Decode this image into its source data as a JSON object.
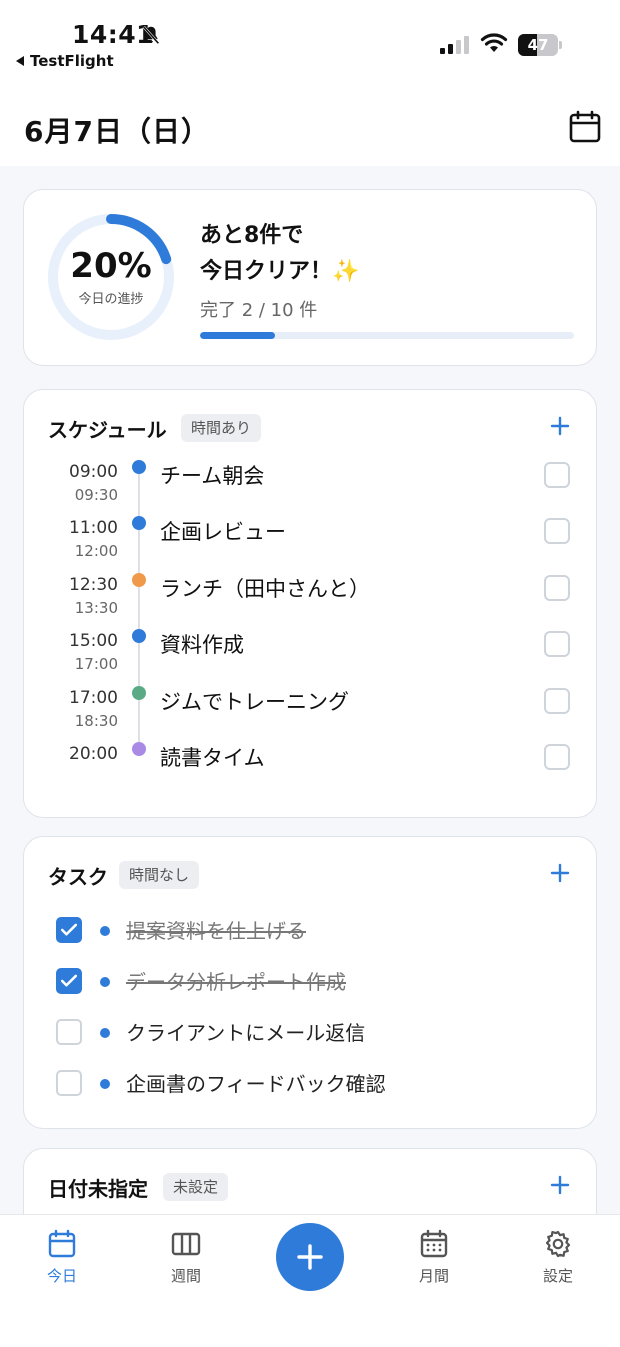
{
  "status": {
    "time": "14:41",
    "back_app": "TestFlight",
    "battery": "47",
    "battery_level": 0.47
  },
  "header": {
    "date": "6月7日（日）"
  },
  "progress": {
    "percent_text": "20%",
    "percent": 0.2,
    "label": "今日の進捗",
    "message_line1": "あと8件で",
    "message_line2": "今日クリア！",
    "sparkle": "✨",
    "done_text": "完了 2 / 10 件"
  },
  "schedule": {
    "title": "スケジュール",
    "chip": "時間あり",
    "add": "+",
    "items": [
      {
        "start": "09:00",
        "end": "09:30",
        "name": "チーム朝会",
        "color": "#2f7bd9",
        "done": false
      },
      {
        "start": "11:00",
        "end": "12:00",
        "name": "企画レビュー",
        "color": "#2f7bd9",
        "done": false
      },
      {
        "start": "12:30",
        "end": "13:30",
        "name": "ランチ（田中さんと）",
        "color": "#f0994a",
        "done": false
      },
      {
        "start": "15:00",
        "end": "17:00",
        "name": "資料作成",
        "color": "#2f7bd9",
        "done": false
      },
      {
        "start": "17:00",
        "end": "18:30",
        "name": "ジムでトレーニング",
        "color": "#5aaa85",
        "done": false
      },
      {
        "start": "20:00",
        "end": "",
        "name": "読書タイム",
        "color": "#a98be6",
        "done": false
      }
    ]
  },
  "tasks": {
    "title": "タスク",
    "chip": "時間なし",
    "add": "+",
    "items": [
      {
        "name": "提案資料を仕上げる",
        "done": true
      },
      {
        "name": "データ分析レポート作成",
        "done": true
      },
      {
        "name": "クライアントにメール返信",
        "done": false
      },
      {
        "name": "企画書のフィードバック確認",
        "done": false
      }
    ]
  },
  "unscheduled": {
    "title": "日付未指定",
    "chip": "未設定",
    "add": "+"
  },
  "nav": {
    "today": "今日",
    "week": "週間",
    "month": "月間",
    "settings": "設定",
    "accent": "#2f7bd9"
  }
}
